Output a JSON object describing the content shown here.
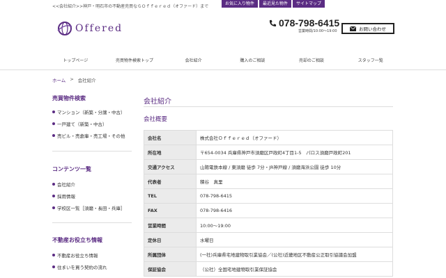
{
  "header": {
    "tagline": "<<会社紹介>>神戸・明石市の不動産売買ならＯｆｆｅｒｅｄ（オファード）まで",
    "tabs": [
      "お気に入り物件",
      "最近見た物件",
      "サイトマップ"
    ],
    "logo_text": "Offered",
    "phone": "078-798-6415",
    "hours": "営業時間/10:00〜19:00",
    "contact_label": "お問い合わせ"
  },
  "nav": [
    "トップページ",
    "売買物件検索トップ",
    "会社紹介",
    "購入のご相談",
    "売却のご相談",
    "スタッフ一覧"
  ],
  "breadcrumb": {
    "home": "ホーム",
    "sep": ">",
    "current": "会社紹介"
  },
  "sidebar": {
    "search": {
      "heading": "売買物件検索",
      "items": [
        "マンション（新築・分譲・中古）",
        "一戸建て（新築・中古）",
        "売ビル・売倉庫・売工場・その他"
      ]
    },
    "contents": {
      "heading": "コンテンツ一覧",
      "items": [
        "会社紹介",
        "採用情報",
        "学校区一覧［須磨・長田・兵庫］"
      ]
    },
    "info": {
      "heading": "不動産お役立ち情報",
      "items": [
        "不動産お役立ち情報",
        "住まいを買う契約の流れ"
      ]
    }
  },
  "main": {
    "title": "会社紹介",
    "section": "会社概要",
    "rows": [
      {
        "k": "会社名",
        "v": "株式会社Ｏｆｆｅｒｅｄ（オファード）"
      },
      {
        "k": "所在地",
        "v": "〒654-0034 兵庫県神戸市須磨区戸政町4丁目1-5　パロス須磨戸政町201"
      },
      {
        "k": "交通アクセス",
        "v": "山陽電鉄本線 / 東須磨 徒歩 7分・JR神戸線 / 須磨海浜公園 徒歩 10分"
      },
      {
        "k": "代表者",
        "v": "積谷　真里"
      },
      {
        "k": "TEL",
        "v": "078-798-6415"
      },
      {
        "k": "FAX",
        "v": "078-798-6416"
      },
      {
        "k": "営業時間",
        "v": "10:00〜19:00"
      },
      {
        "k": "定休日",
        "v": "水曜日"
      },
      {
        "k": "所属団体",
        "v": "(一社)兵庫県宅地建物取引業協会／(公社)近畿地区不動産公正取引協議会加盟"
      },
      {
        "k": "保証協会",
        "v": "（公社）全国宅地建物取引業保証協会"
      }
    ]
  },
  "colors": {
    "accent": "#5b2c83",
    "label_bg": "#ebebeb"
  }
}
